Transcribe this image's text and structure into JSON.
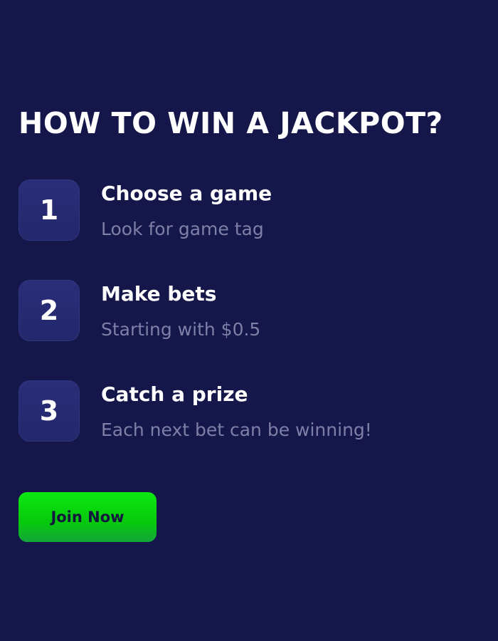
{
  "header": {
    "title": "HOW TO WIN A JACKPOT?"
  },
  "steps": [
    {
      "number": "1",
      "title": "Choose a game",
      "subtitle": "Look for game tag"
    },
    {
      "number": "2",
      "title": "Make bets",
      "subtitle": "Starting with $0.5"
    },
    {
      "number": "3",
      "title": "Catch a prize",
      "subtitle": "Each next bet can be winning!"
    }
  ],
  "cta": {
    "label": "Join Now"
  },
  "colors": {
    "background": "#15174a",
    "badge": "#272b74",
    "subtitle_text": "#7d80a6",
    "cta_green": "#0be810",
    "cta_text": "#14183f"
  }
}
